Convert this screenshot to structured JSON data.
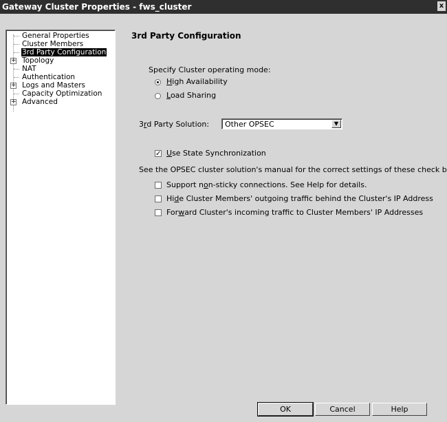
{
  "window": {
    "title": "Gateway Cluster Properties - fws_cluster",
    "close_glyph": "x"
  },
  "tree": {
    "items": [
      {
        "label": "General Properties",
        "expandable": false,
        "selected": false
      },
      {
        "label": "Cluster Members",
        "expandable": false,
        "selected": false
      },
      {
        "label": "3rd Party Configuration",
        "expandable": false,
        "selected": true
      },
      {
        "label": "Topology",
        "expandable": true,
        "selected": false
      },
      {
        "label": "NAT",
        "expandable": false,
        "selected": false
      },
      {
        "label": "Authentication",
        "expandable": false,
        "selected": false
      },
      {
        "label": "Logs and Masters",
        "expandable": true,
        "selected": false
      },
      {
        "label": "Capacity Optimization",
        "expandable": false,
        "selected": false
      },
      {
        "label": "Advanced",
        "expandable": true,
        "selected": false
      }
    ],
    "expander_glyph": "+"
  },
  "panel": {
    "title": "3rd Party Configuration",
    "mode_label": "Specify Cluster operating mode:",
    "modes": [
      {
        "pre": "",
        "mnemonic": "H",
        "post": "igh Availability",
        "selected": true
      },
      {
        "pre": "",
        "mnemonic": "L",
        "post": "oad Sharing",
        "selected": false
      }
    ],
    "solution_label": {
      "pre": "3",
      "mnemonic": "r",
      "post": "d Party Solution:"
    },
    "solution_value": "Other OPSEC",
    "dropdown_arrow": "▼",
    "state_sync": {
      "pre": "",
      "mnemonic": "U",
      "post": "se State Synchronization",
      "checked": true
    },
    "note": "See the OPSEC cluster solution's manual for the correct settings of these check boxes",
    "options": [
      {
        "pre": "Support n",
        "mnemonic": "o",
        "post": "n-sticky connections. See Help for details.",
        "checked": false
      },
      {
        "pre": "Hi",
        "mnemonic": "d",
        "post": "e Cluster Members' outgoing traffic behind the Cluster's IP Address",
        "checked": false
      },
      {
        "pre": "For",
        "mnemonic": "w",
        "post": "ard Cluster's incoming traffic to Cluster Members' IP Addresses",
        "checked": false
      }
    ],
    "check_glyph": "✓"
  },
  "buttons": {
    "ok": "OK",
    "cancel": "Cancel",
    "help": "Help"
  }
}
